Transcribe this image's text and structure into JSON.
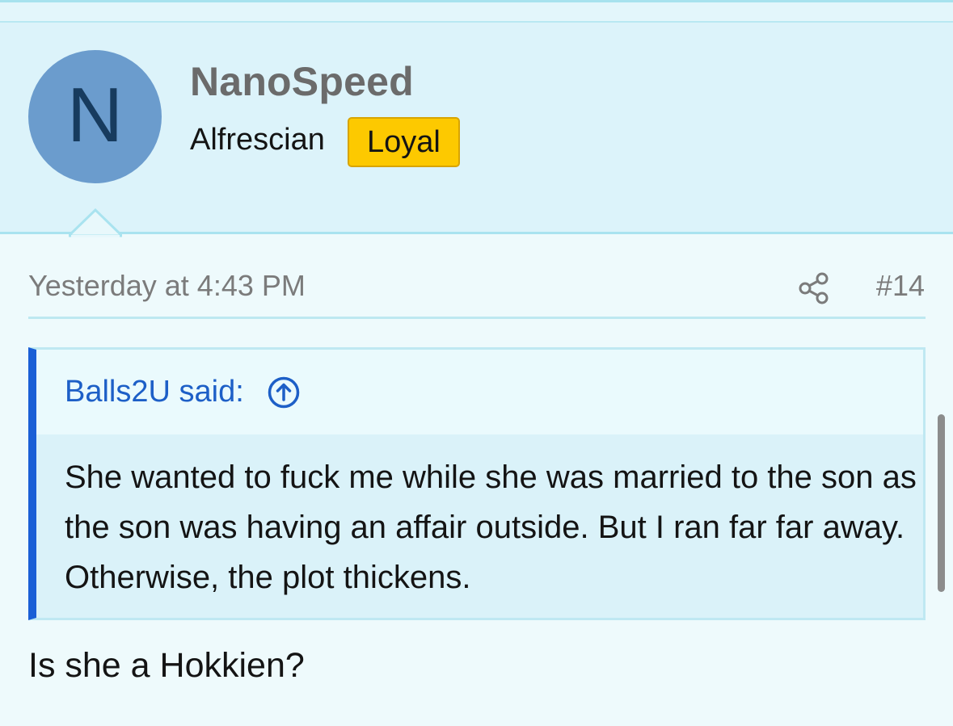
{
  "post": {
    "author": {
      "avatar_initial": "N",
      "username": "NanoSpeed",
      "title": "Alfrescian",
      "badge": "Loyal"
    },
    "date": "Yesterday at 4:43 PM",
    "share_icon": "share-icon",
    "number": "#14",
    "quote": {
      "author_said": "Balls2U said:",
      "jump_icon": "arrow-up-circle-icon",
      "text": "She wanted to fuck me while she was married to the son as the son was having an affair outside. But I ran far far away. Otherwise, the plot thickens."
    },
    "reply": "Is she a Hokkien?"
  },
  "colors": {
    "avatar_bg": "#6b9ccd",
    "badge_bg": "#fdc900",
    "quote_accent": "#1a5fd6",
    "link": "#1d5fc7"
  }
}
